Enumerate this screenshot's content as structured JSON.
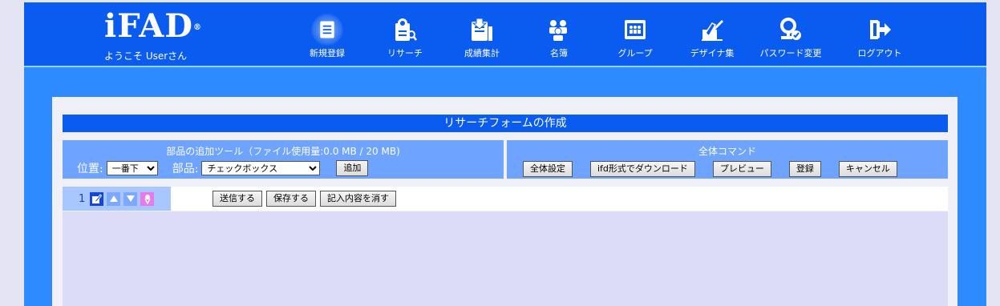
{
  "header": {
    "logo": "iFAD",
    "logo_mark": "®",
    "welcome": "ようこそ Userさん",
    "nav": [
      {
        "label": "新規登録",
        "icon": "document-icon"
      },
      {
        "label": "リサーチ",
        "icon": "research-icon"
      },
      {
        "label": "成績集計",
        "icon": "download-tally-icon"
      },
      {
        "label": "名簿",
        "icon": "people-roster-icon"
      },
      {
        "label": "グループ",
        "icon": "group-icon"
      },
      {
        "label": "デザイナ集",
        "icon": "designer-pen-icon"
      },
      {
        "label": "パスワード変更",
        "icon": "password-key-icon"
      },
      {
        "label": "ログアウト",
        "icon": "logout-icon"
      }
    ]
  },
  "page": {
    "title": "リサーチフォームの作成"
  },
  "tools": {
    "title": "部品の追加ツール（ファイル使用量:0.0 MB / 20 MB)",
    "position_label": "位置:",
    "position_value": "一番下",
    "part_label": "部品:",
    "part_value": "チェックボックス",
    "add_button": "追加"
  },
  "commands": {
    "title": "全体コマンド",
    "buttons": [
      "全体設定",
      "ifd形式でダウンロード",
      "プレビュー",
      "登録",
      "キャンセル"
    ]
  },
  "form": {
    "item_number": "1",
    "buttons": [
      "送信する",
      "保存する",
      "記入内容を消す"
    ]
  },
  "colors": {
    "header_bg": "#0a5cf0",
    "band_bg": "#2e8bff",
    "section_bg": "#6ea3ff",
    "item_ctrl_bg": "#a8c6ff",
    "form_area_bg": "#dcdcf8"
  }
}
